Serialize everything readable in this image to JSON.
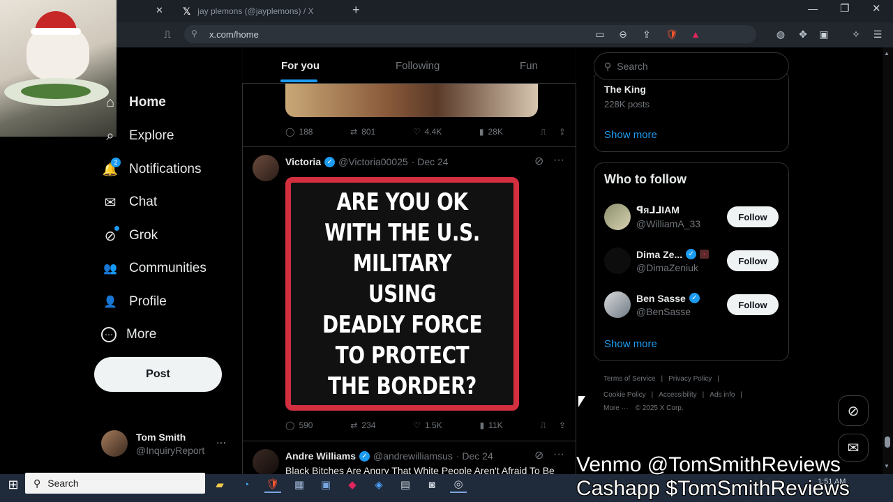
{
  "browser": {
    "prev_tab_close": "✕",
    "active_tab_title": "jay plemons (@jayplemons) / X",
    "new_tab": "+",
    "url": "x.com/home",
    "window_controls": {
      "minimize": "—",
      "restore": "❐",
      "close": "✕"
    }
  },
  "nav": {
    "items": [
      {
        "label": "Home",
        "icon": "home-icon",
        "glyph": "⌂"
      },
      {
        "label": "Explore",
        "icon": "search-icon",
        "glyph": "⌕"
      },
      {
        "label": "Notifications",
        "icon": "bell-icon",
        "glyph": "🔔",
        "badge": "2"
      },
      {
        "label": "Chat",
        "icon": "mail-icon",
        "glyph": "✉"
      },
      {
        "label": "Grok",
        "icon": "grok-icon",
        "glyph": "⊘"
      },
      {
        "label": "Communities",
        "icon": "people-icon",
        "glyph": "👥"
      },
      {
        "label": "Profile",
        "icon": "person-icon",
        "glyph": "👤"
      },
      {
        "label": "More",
        "icon": "more-circle-icon",
        "glyph": "⋯"
      }
    ],
    "post_label": "Post",
    "account": {
      "name": "Tom Smith",
      "handle": "@InquiryReport",
      "more": "···"
    }
  },
  "timeline": {
    "tabs": [
      "For you",
      "Following",
      "Fun"
    ],
    "prev_tweet_stats": {
      "replies": "188",
      "reposts": "801",
      "likes": "4.4K",
      "views": "28K"
    },
    "tweet": {
      "name": "Victoria",
      "handle": "@Victoria00025",
      "date": "· Dec 24",
      "poster_lines": [
        "ARE YOU OK",
        "WITH THE U.S.",
        "MILITARY USING",
        "DEADLY FORCE",
        "TO PROTECT",
        "THE BORDER?"
      ],
      "stats": {
        "replies": "590",
        "reposts": "234",
        "likes": "1.5K",
        "views": "11K"
      }
    },
    "next_tweet": {
      "name": "Andre Williams",
      "handle": "@andrewilliamsus",
      "date": "· Dec 24",
      "text": "Black Bitches Are Angry That White People Aren't Afraid To Be"
    }
  },
  "right": {
    "search_placeholder": "Search",
    "trend": {
      "name": "The King",
      "count": "228K posts"
    },
    "show_more": "Show more",
    "who_to_follow_title": "Who to follow",
    "suggestions": [
      {
        "name": "ꟼᴙ⅃⅃IAM",
        "handle": "@WilliamA_33",
        "verified": false
      },
      {
        "name": "Dima Ze...",
        "handle": "@DimaZeniuk",
        "verified": true
      },
      {
        "name": "Ben Sasse",
        "handle": "@BenSasse",
        "verified": true
      }
    ],
    "follow_label": "Follow",
    "footer": {
      "links_row1": [
        "Terms of Service",
        "Privacy Policy"
      ],
      "links_row2": [
        "Cookie Policy",
        "Accessibility",
        "Ads info"
      ],
      "more": "More ···",
      "copyright": "© 2025 X Corp."
    }
  },
  "taskbar": {
    "search_label": "Search",
    "clock": "1:51 AM"
  },
  "overlay": {
    "venmo": "Venmo @TomSmithReviews",
    "cashapp": "Cashapp $TomSmithReviews"
  },
  "colors": {
    "accent": "#1d9bf0",
    "poster_border": "#d32f3f",
    "background": "#000000"
  }
}
